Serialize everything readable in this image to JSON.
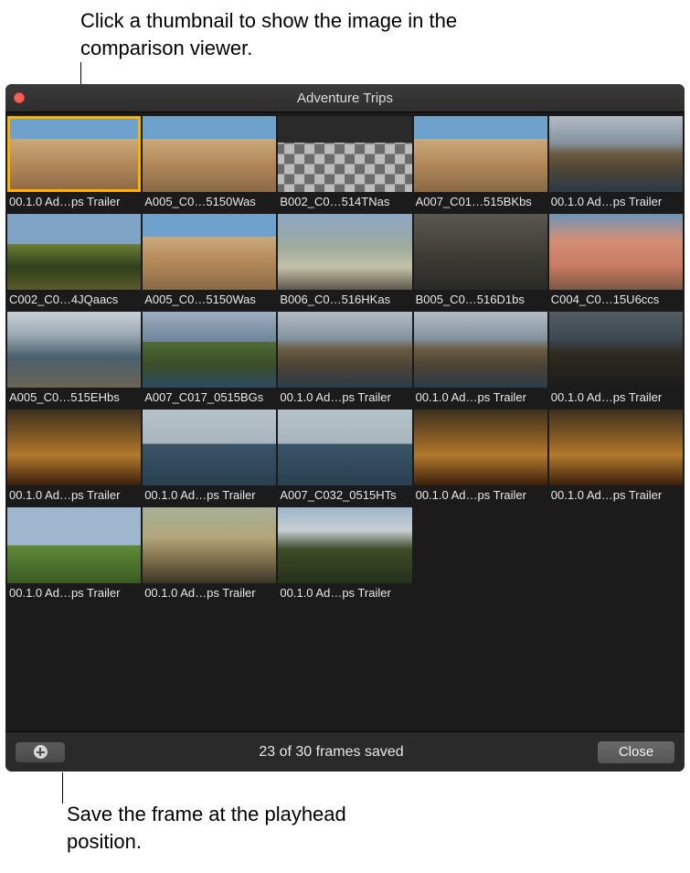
{
  "annotations": {
    "top": "Click a thumbnail to show the image in the comparison viewer.",
    "bottom": "Save the frame at the playhead position."
  },
  "window": {
    "title": "Adventure Trips"
  },
  "thumbnails": [
    {
      "label": "00.1.0 Ad…ps Trailer",
      "style": "im-buildings",
      "selected": true
    },
    {
      "label": "A005_C0…5150Was",
      "style": "im-buildings"
    },
    {
      "label": "B002_C0…514TNas",
      "style": "im-checker"
    },
    {
      "label": "A007_C01…515BKbs",
      "style": "im-buildings"
    },
    {
      "label": "00.1.0 Ad…ps Trailer",
      "style": "im-cliff"
    },
    {
      "label": "C002_C0…4JQaacs",
      "style": "im-trees"
    },
    {
      "label": "A005_C0…5150Was",
      "style": "im-buildings"
    },
    {
      "label": "B006_C0…516HKas",
      "style": "im-flag"
    },
    {
      "label": "B005_C0…516D1bs",
      "style": "im-alley"
    },
    {
      "label": "C004_C0…15U6ccs",
      "style": "im-pink-houses"
    },
    {
      "label": "A005_C0…515EHbs",
      "style": "im-boats"
    },
    {
      "label": "A007_C017_0515BGs",
      "style": "im-hills-sea"
    },
    {
      "label": "00.1.0 Ad…ps Trailer",
      "style": "im-cliff"
    },
    {
      "label": "00.1.0 Ad…ps Trailer",
      "style": "im-cliff"
    },
    {
      "label": "00.1.0 Ad…ps Trailer",
      "style": "im-cliff-dark"
    },
    {
      "label": "00.1.0 Ad…ps Trailer",
      "style": "im-gold-cliff"
    },
    {
      "label": "00.1.0 Ad…ps Trailer",
      "style": "im-sea-horizon"
    },
    {
      "label": "A007_C032_0515HTs",
      "style": "im-sea-horizon"
    },
    {
      "label": "00.1.0 Ad…ps Trailer",
      "style": "im-gold-cliff"
    },
    {
      "label": "00.1.0 Ad…ps Trailer",
      "style": "im-gold-cliff"
    },
    {
      "label": "00.1.0 Ad…ps Trailer",
      "style": "im-green-sky"
    },
    {
      "label": "00.1.0 Ad…ps Trailer",
      "style": "im-tower"
    },
    {
      "label": "00.1.0 Ad…ps Trailer",
      "style": "im-mountains"
    }
  ],
  "footer": {
    "status": "23 of 30 frames saved",
    "close_label": "Close"
  }
}
